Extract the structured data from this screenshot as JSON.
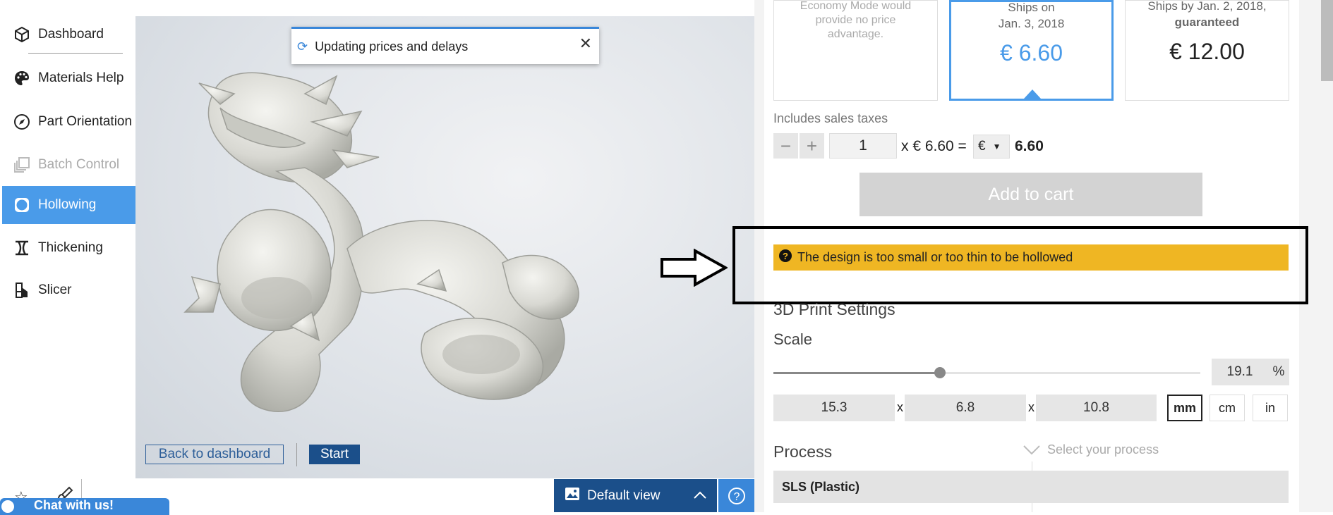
{
  "sidebar": {
    "items": [
      {
        "label": "Dashboard",
        "icon": "cube-icon"
      },
      {
        "label": "Materials Help",
        "icon": "palette-icon"
      },
      {
        "label": "Part Orientation",
        "icon": "compass-icon"
      },
      {
        "label": "Batch Control",
        "icon": "layers-icon"
      },
      {
        "label": "Hollowing",
        "icon": "circle-icon"
      },
      {
        "label": "Thickening",
        "icon": "thickening-icon"
      },
      {
        "label": "Slicer",
        "icon": "slicer-icon"
      }
    ]
  },
  "viewer": {
    "toast": "Updating prices and delays",
    "back_button": "Back to dashboard",
    "start_button": "Start",
    "view_label": "Default view"
  },
  "chat": {
    "label": "Chat with us!"
  },
  "pricing": {
    "card1": {
      "text": "Economy Mode would provide no price advantage."
    },
    "card2": {
      "line1": "Ships on",
      "line2": "Jan. 3, 2018",
      "price": "€ 6.60"
    },
    "card3": {
      "line1": "Ships by Jan. 2, 2018,",
      "line2": "guaranteed",
      "price": "€ 12.00"
    },
    "taxes": "Includes sales taxes",
    "quantity": "1",
    "unit_price": "x € 6.60 =",
    "currency": "€",
    "total": "6.60",
    "add_to_cart": "Add to cart"
  },
  "warning": {
    "text": "The design is too small or too thin to be hollowed"
  },
  "settings": {
    "title": "3D Print Settings",
    "scale_label": "Scale",
    "scale_value": "19.1",
    "scale_unit": "%",
    "scale_fraction": 0.39,
    "dims": [
      "15.3",
      "6.8",
      "10.8"
    ],
    "times": "x",
    "units": [
      "mm",
      "cm",
      "in"
    ],
    "selected_unit": "mm",
    "process_label": "Process",
    "process_placeholder": "Select your process",
    "process_option": "SLS (Plastic)"
  },
  "colors": {
    "accent": "#4a9be9",
    "navy": "#1b4f8a",
    "warning": "#efb623"
  }
}
